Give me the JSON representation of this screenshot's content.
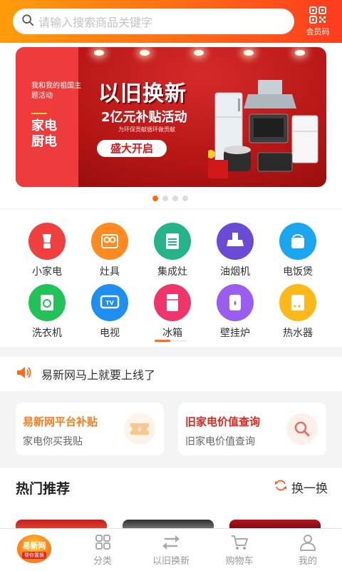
{
  "header": {
    "search_placeholder": "请输入搜索商品关键字",
    "member_code_label": "会员码"
  },
  "banner": {
    "side_small": "我和我的祖国主题活动",
    "side_big": "家电厨电",
    "title": "以旧换新",
    "subtitle": "2亿元补贴活动",
    "tagline": "为环保贡献循环做贡献",
    "button": "盛大开启",
    "slide_count": 4,
    "active_slide": 1
  },
  "categories": [
    {
      "label": "小家电",
      "icon": "blender-icon",
      "color": "#ef3f3f"
    },
    {
      "label": "灶具",
      "icon": "stove-icon",
      "color": "#ff8a1f"
    },
    {
      "label": "集成灶",
      "icon": "integrated-stove-icon",
      "color": "#25b38a"
    },
    {
      "label": "油烟机",
      "icon": "range-hood-icon",
      "color": "#6b4bd6"
    },
    {
      "label": "电饭煲",
      "icon": "rice-cooker-icon",
      "color": "#1aa7f0"
    },
    {
      "label": "洗衣机",
      "icon": "washing-machine-icon",
      "color": "#21c25a"
    },
    {
      "label": "电视",
      "icon": "tv-icon",
      "color": "#1e8ef0"
    },
    {
      "label": "冰箱",
      "icon": "fridge-icon",
      "color": "#f0356a"
    },
    {
      "label": "壁挂炉",
      "icon": "boiler-icon",
      "color": "#9b5cf0"
    },
    {
      "label": "热水器",
      "icon": "water-heater-icon",
      "color": "#ffb81a"
    }
  ],
  "notice": {
    "text": "易新网马上就要上线了"
  },
  "promos": [
    {
      "title": "易新网平台补贴",
      "subtitle": "家电你买我贴",
      "title_color": "#ff7a1a",
      "icon": "voucher-icon"
    },
    {
      "title": "旧家电价值查询",
      "subtitle": "旧家电价值查询",
      "title_color": "#e3251b",
      "icon": "search-icon"
    }
  ],
  "hot": {
    "title": "热门推荐",
    "refresh_label": "换一换"
  },
  "nav": {
    "logo_text": "易新网",
    "logo_sub": "帮你置换",
    "items": [
      {
        "label": "分类",
        "icon": "category-grid-icon"
      },
      {
        "label": "以旧换新",
        "icon": "exchange-icon"
      },
      {
        "label": "购物车",
        "icon": "cart-icon"
      },
      {
        "label": "我的",
        "icon": "user-icon"
      }
    ]
  }
}
